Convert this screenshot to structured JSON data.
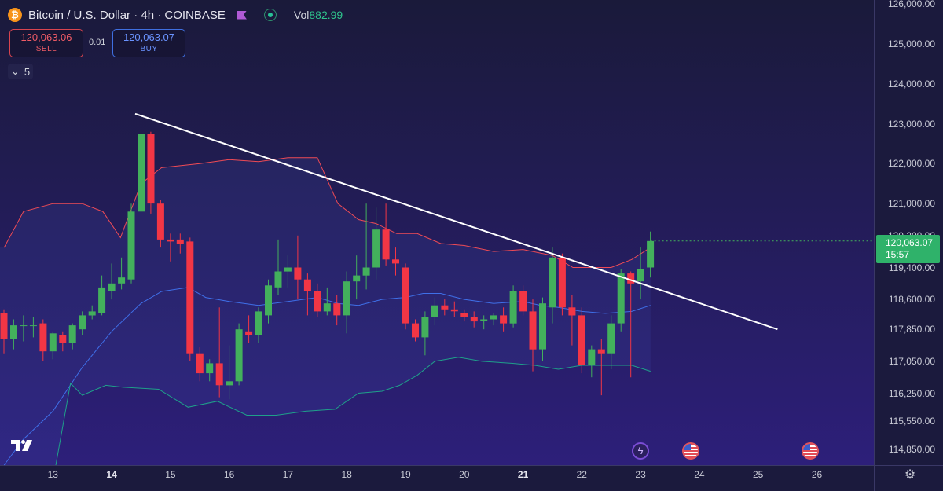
{
  "header": {
    "symbol_icon": "bitcoin-icon",
    "title": "Bitcoin / U.S. Dollar · 4h · COINBASE",
    "vol_label": "Vol",
    "vol_value": "882.99"
  },
  "trade": {
    "sell_price": "120,063.06",
    "sell_label": "SELL",
    "spread": "0.01",
    "buy_price": "120,063.07",
    "buy_label": "BUY"
  },
  "indicators_toggle": {
    "icon": "chevron-down-icon",
    "count": "5"
  },
  "current_price": {
    "price": "120,063.07",
    "countdown": "15:57"
  },
  "colors": {
    "up": "#43b05c",
    "down": "#f23645",
    "bb_upper": "#ef4b55",
    "bb_mid": "#3f6fe8",
    "bb_lower": "#1fa08a",
    "trendline": "#ffffff"
  },
  "chart_data": {
    "type": "candlestick",
    "interval": "4h",
    "y_axis": {
      "ticks": [
        "126,000.00",
        "125,000.00",
        "124,000.00",
        "123,000.00",
        "122,000.00",
        "121,000.00",
        "120,200.00",
        "119,400.00",
        "118,600.00",
        "117,850.00",
        "117,050.00",
        "116,250.00",
        "115,550.00",
        "114,850.00"
      ],
      "ylim": [
        114450,
        126100
      ]
    },
    "x_axis": {
      "ticks": [
        {
          "label": "13",
          "day": 13
        },
        {
          "label": "14",
          "day": 14,
          "bold": true
        },
        {
          "label": "15",
          "day": 15
        },
        {
          "label": "16",
          "day": 16
        },
        {
          "label": "17",
          "day": 17
        },
        {
          "label": "18",
          "day": 18
        },
        {
          "label": "19",
          "day": 19
        },
        {
          "label": "20",
          "day": 20
        },
        {
          "label": "21",
          "day": 21,
          "bold": true
        },
        {
          "label": "22",
          "day": 22
        },
        {
          "label": "23",
          "day": 23
        },
        {
          "label": "24",
          "day": 24
        },
        {
          "label": "25",
          "day": 25
        },
        {
          "label": "26",
          "day": 26
        }
      ],
      "xlim": [
        12.1,
        26.97
      ]
    },
    "candles": [
      {
        "t": 12.1667,
        "o": 118250,
        "h": 118350,
        "l": 117250,
        "c": 117600
      },
      {
        "t": 12.3333,
        "o": 117600,
        "h": 118100,
        "l": 117350,
        "c": 117950
      },
      {
        "t": 12.5,
        "o": 117950,
        "h": 118200,
        "l": 117550,
        "c": 117950
      },
      {
        "t": 12.6667,
        "o": 117950,
        "h": 118150,
        "l": 117650,
        "c": 117950
      },
      {
        "t": 12.8333,
        "o": 118000,
        "h": 118100,
        "l": 117050,
        "c": 117300
      },
      {
        "t": 13.0,
        "o": 117300,
        "h": 117800,
        "l": 117100,
        "c": 117750
      },
      {
        "t": 13.1667,
        "o": 117700,
        "h": 117800,
        "l": 117300,
        "c": 117500
      },
      {
        "t": 13.3333,
        "o": 117500,
        "h": 118000,
        "l": 117350,
        "c": 117950
      },
      {
        "t": 13.5,
        "o": 117850,
        "h": 118300,
        "l": 117700,
        "c": 118200
      },
      {
        "t": 13.6667,
        "o": 118200,
        "h": 118450,
        "l": 118100,
        "c": 118300
      },
      {
        "t": 13.8333,
        "o": 118250,
        "h": 119200,
        "l": 118200,
        "c": 118900
      },
      {
        "t": 14.0,
        "o": 118800,
        "h": 119500,
        "l": 118600,
        "c": 119000
      },
      {
        "t": 14.1667,
        "o": 119000,
        "h": 119650,
        "l": 118850,
        "c": 119150
      },
      {
        "t": 14.3333,
        "o": 119100,
        "h": 121000,
        "l": 119000,
        "c": 120800
      },
      {
        "t": 14.5,
        "o": 120800,
        "h": 123100,
        "l": 120600,
        "c": 122750
      },
      {
        "t": 14.6667,
        "o": 122750,
        "h": 122800,
        "l": 120750,
        "c": 121000
      },
      {
        "t": 14.8333,
        "o": 121000,
        "h": 121100,
        "l": 119900,
        "c": 120100
      },
      {
        "t": 15.0,
        "o": 120100,
        "h": 120250,
        "l": 119550,
        "c": 120050
      },
      {
        "t": 15.1667,
        "o": 120100,
        "h": 120250,
        "l": 119750,
        "c": 120000
      },
      {
        "t": 15.3333,
        "o": 120050,
        "h": 120150,
        "l": 117050,
        "c": 117250
      },
      {
        "t": 15.5,
        "o": 117250,
        "h": 117400,
        "l": 116550,
        "c": 116750
      },
      {
        "t": 15.6667,
        "o": 116750,
        "h": 117100,
        "l": 116550,
        "c": 117000
      },
      {
        "t": 15.8333,
        "o": 117000,
        "h": 118400,
        "l": 116150,
        "c": 116450
      },
      {
        "t": 16.0,
        "o": 116450,
        "h": 117450,
        "l": 116100,
        "c": 116550
      },
      {
        "t": 16.1667,
        "o": 116550,
        "h": 118000,
        "l": 116450,
        "c": 117850
      },
      {
        "t": 16.3333,
        "o": 117800,
        "h": 118200,
        "l": 117500,
        "c": 117700
      },
      {
        "t": 16.5,
        "o": 117700,
        "h": 118400,
        "l": 117500,
        "c": 118300
      },
      {
        "t": 16.6667,
        "o": 118200,
        "h": 119100,
        "l": 118000,
        "c": 118950
      },
      {
        "t": 16.8333,
        "o": 118900,
        "h": 120100,
        "l": 118700,
        "c": 119300
      },
      {
        "t": 17.0,
        "o": 119300,
        "h": 119700,
        "l": 118900,
        "c": 119400
      },
      {
        "t": 17.1667,
        "o": 119400,
        "h": 120200,
        "l": 118600,
        "c": 119100
      },
      {
        "t": 17.3333,
        "o": 119100,
        "h": 119250,
        "l": 118200,
        "c": 118800
      },
      {
        "t": 17.5,
        "o": 118800,
        "h": 119000,
        "l": 118150,
        "c": 118300
      },
      {
        "t": 17.6667,
        "o": 118300,
        "h": 118900,
        "l": 118200,
        "c": 118500
      },
      {
        "t": 17.8333,
        "o": 118500,
        "h": 118700,
        "l": 117950,
        "c": 118200
      },
      {
        "t": 18.0,
        "o": 118200,
        "h": 119300,
        "l": 117750,
        "c": 119050
      },
      {
        "t": 18.1667,
        "o": 119050,
        "h": 119700,
        "l": 118600,
        "c": 119200
      },
      {
        "t": 18.3333,
        "o": 119200,
        "h": 121000,
        "l": 118850,
        "c": 119400
      },
      {
        "t": 18.5,
        "o": 119400,
        "h": 120900,
        "l": 119100,
        "c": 120350
      },
      {
        "t": 18.6667,
        "o": 120350,
        "h": 121000,
        "l": 119450,
        "c": 119600
      },
      {
        "t": 18.8333,
        "o": 119600,
        "h": 119900,
        "l": 119200,
        "c": 119500
      },
      {
        "t": 19.0,
        "o": 119400,
        "h": 119500,
        "l": 117850,
        "c": 118000
      },
      {
        "t": 19.1667,
        "o": 118000,
        "h": 118100,
        "l": 117550,
        "c": 117650
      },
      {
        "t": 19.3333,
        "o": 117650,
        "h": 118300,
        "l": 117200,
        "c": 118150
      },
      {
        "t": 19.5,
        "o": 118150,
        "h": 118650,
        "l": 117950,
        "c": 118450
      },
      {
        "t": 19.6667,
        "o": 118450,
        "h": 118600,
        "l": 118200,
        "c": 118350
      },
      {
        "t": 19.8333,
        "o": 118350,
        "h": 118550,
        "l": 118150,
        "c": 118300
      },
      {
        "t": 20.0,
        "o": 118250,
        "h": 118350,
        "l": 118050,
        "c": 118150
      },
      {
        "t": 20.1667,
        "o": 118150,
        "h": 118300,
        "l": 117900,
        "c": 118050
      },
      {
        "t": 20.3333,
        "o": 118050,
        "h": 118200,
        "l": 117850,
        "c": 118100
      },
      {
        "t": 20.5,
        "o": 118100,
        "h": 118250,
        "l": 117950,
        "c": 118200
      },
      {
        "t": 20.6667,
        "o": 118200,
        "h": 118400,
        "l": 117800,
        "c": 118000
      },
      {
        "t": 20.8333,
        "o": 118000,
        "h": 118950,
        "l": 117900,
        "c": 118800
      },
      {
        "t": 21.0,
        "o": 118800,
        "h": 118950,
        "l": 118200,
        "c": 118300
      },
      {
        "t": 21.1667,
        "o": 118300,
        "h": 118600,
        "l": 116800,
        "c": 117350
      },
      {
        "t": 21.3333,
        "o": 117350,
        "h": 118650,
        "l": 117050,
        "c": 118500
      },
      {
        "t": 21.5,
        "o": 118400,
        "h": 119900,
        "l": 118000,
        "c": 119650
      },
      {
        "t": 21.6667,
        "o": 119650,
        "h": 119750,
        "l": 118200,
        "c": 118400
      },
      {
        "t": 21.8333,
        "o": 118400,
        "h": 118700,
        "l": 117450,
        "c": 118200
      },
      {
        "t": 22.0,
        "o": 118200,
        "h": 118400,
        "l": 116750,
        "c": 116950
      },
      {
        "t": 22.1667,
        "o": 116950,
        "h": 117450,
        "l": 116650,
        "c": 117350
      },
      {
        "t": 22.3333,
        "o": 117350,
        "h": 117600,
        "l": 116200,
        "c": 117250
      },
      {
        "t": 22.5,
        "o": 117250,
        "h": 118200,
        "l": 116850,
        "c": 118000
      },
      {
        "t": 22.6667,
        "o": 118000,
        "h": 119350,
        "l": 117800,
        "c": 119250
      },
      {
        "t": 22.8333,
        "o": 119250,
        "h": 119300,
        "l": 116650,
        "c": 119000
      },
      {
        "t": 23.0,
        "o": 119050,
        "h": 119900,
        "l": 118600,
        "c": 119350
      },
      {
        "t": 23.1667,
        "o": 119400,
        "h": 120300,
        "l": 119150,
        "c": 120063
      }
    ],
    "bollinger": {
      "upper": [
        [
          12.17,
          119900
        ],
        [
          12.5,
          120800
        ],
        [
          13.0,
          121000
        ],
        [
          13.5,
          121000
        ],
        [
          13.85,
          120800
        ],
        [
          14.15,
          120150
        ],
        [
          14.5,
          121500
        ],
        [
          14.85,
          121900
        ],
        [
          15.5,
          122000
        ],
        [
          16.0,
          122100
        ],
        [
          16.5,
          122050
        ],
        [
          17.0,
          122150
        ],
        [
          17.5,
          122150
        ],
        [
          17.85,
          121000
        ],
        [
          18.2,
          120600
        ],
        [
          18.5,
          120500
        ],
        [
          18.85,
          120250
        ],
        [
          19.2,
          120250
        ],
        [
          19.6,
          120000
        ],
        [
          20.0,
          119950
        ],
        [
          20.5,
          119800
        ],
        [
          21.0,
          119850
        ],
        [
          21.5,
          119700
        ],
        [
          21.85,
          119400
        ],
        [
          22.2,
          119400
        ],
        [
          22.5,
          119400
        ],
        [
          22.85,
          119600
        ],
        [
          23.17,
          119900
        ]
      ],
      "middle": [
        [
          12.17,
          114450
        ],
        [
          12.5,
          115100
        ],
        [
          13.0,
          115800
        ],
        [
          13.5,
          116900
        ],
        [
          14.0,
          117800
        ],
        [
          14.5,
          118500
        ],
        [
          14.85,
          118800
        ],
        [
          15.3,
          118900
        ],
        [
          15.6,
          118650
        ],
        [
          16.0,
          118550
        ],
        [
          16.5,
          118450
        ],
        [
          17.0,
          118550
        ],
        [
          17.5,
          118650
        ],
        [
          17.85,
          118500
        ],
        [
          18.2,
          118450
        ],
        [
          18.6,
          118600
        ],
        [
          19.0,
          118650
        ],
        [
          19.3,
          118750
        ],
        [
          19.6,
          118750
        ],
        [
          20.0,
          118600
        ],
        [
          20.5,
          118500
        ],
        [
          21.0,
          118550
        ],
        [
          21.3,
          118450
        ],
        [
          21.6,
          118400
        ],
        [
          22.0,
          118300
        ],
        [
          22.4,
          118250
        ],
        [
          22.85,
          118300
        ],
        [
          23.17,
          118450
        ]
      ],
      "lower": [
        [
          13.05,
          114450
        ],
        [
          13.3,
          116500
        ],
        [
          13.5,
          116200
        ],
        [
          13.9,
          116450
        ],
        [
          14.2,
          116400
        ],
        [
          14.8,
          116350
        ],
        [
          15.3,
          115900
        ],
        [
          15.8,
          116050
        ],
        [
          16.3,
          115700
        ],
        [
          16.8,
          115700
        ],
        [
          17.3,
          115800
        ],
        [
          17.8,
          115850
        ],
        [
          18.2,
          116250
        ],
        [
          18.6,
          116300
        ],
        [
          18.9,
          116450
        ],
        [
          19.2,
          116700
        ],
        [
          19.5,
          117050
        ],
        [
          19.9,
          117150
        ],
        [
          20.3,
          117050
        ],
        [
          20.8,
          117000
        ],
        [
          21.2,
          116950
        ],
        [
          21.6,
          116850
        ],
        [
          22.0,
          116950
        ],
        [
          22.4,
          116950
        ],
        [
          22.85,
          116950
        ],
        [
          23.17,
          116800
        ]
      ]
    },
    "trendline": {
      "t1": 14.4,
      "p1": 123250,
      "t2": 25.33,
      "p2": 117850
    }
  },
  "events": [
    {
      "icon": "lightning-event-icon",
      "day": 23.0
    },
    {
      "icon": "us-flag-event-icon",
      "day": 23.85
    },
    {
      "icon": "us-flag-event-icon",
      "day": 25.88
    }
  ],
  "logo": "TradingView",
  "settings_icon": "gear-icon"
}
